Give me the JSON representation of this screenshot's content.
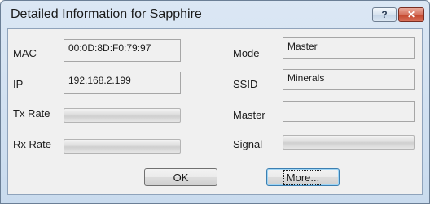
{
  "window": {
    "title": "Detailed Information for Sapphire",
    "help_symbol": "?",
    "close_symbol": "✕"
  },
  "fields": {
    "mac": {
      "label": "MAC",
      "value": "00:0D:8D:F0:79:97"
    },
    "ip": {
      "label": "IP",
      "value": "192.168.2.199"
    },
    "tx_rate": {
      "label": "Tx Rate",
      "level": 0
    },
    "rx_rate": {
      "label": "Rx Rate",
      "level": 0
    },
    "mode": {
      "label": "Mode",
      "value": "Master"
    },
    "ssid": {
      "label": "SSID",
      "value": "Minerals"
    },
    "master": {
      "label": "Master",
      "value": ""
    },
    "signal": {
      "label": "Signal",
      "level": 0
    }
  },
  "buttons": {
    "ok_label": "OK",
    "more_label": "More..."
  }
}
